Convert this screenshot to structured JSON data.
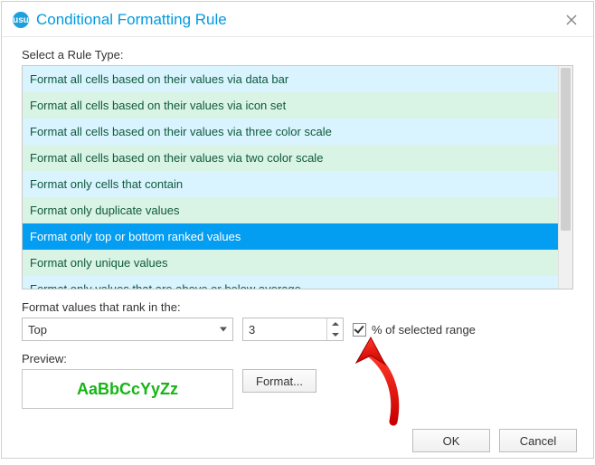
{
  "dialog": {
    "icon_label": "usu",
    "title": "Conditional Formatting Rule",
    "rule_type_label": "Select a Rule Type:",
    "rules": [
      "Format all cells based on their values via data bar",
      "Format all cells based on their values via icon set",
      "Format all cells based on their values via three color scale",
      "Format all cells based on their values via two color scale",
      "Format only cells that contain",
      "Format only duplicate values",
      "Format only top or bottom ranked values",
      "Format only unique values",
      "Format only values that are above or below average"
    ],
    "selected_rule_index": 6,
    "rank_label": "Format values that rank in the:",
    "rank_direction": "Top",
    "rank_value": "3",
    "percent_checked": true,
    "percent_label": "% of selected range",
    "preview_label": "Preview:",
    "preview_text": "AaBbCcYyZz",
    "format_button": "Format...",
    "ok": "OK",
    "cancel": "Cancel"
  }
}
